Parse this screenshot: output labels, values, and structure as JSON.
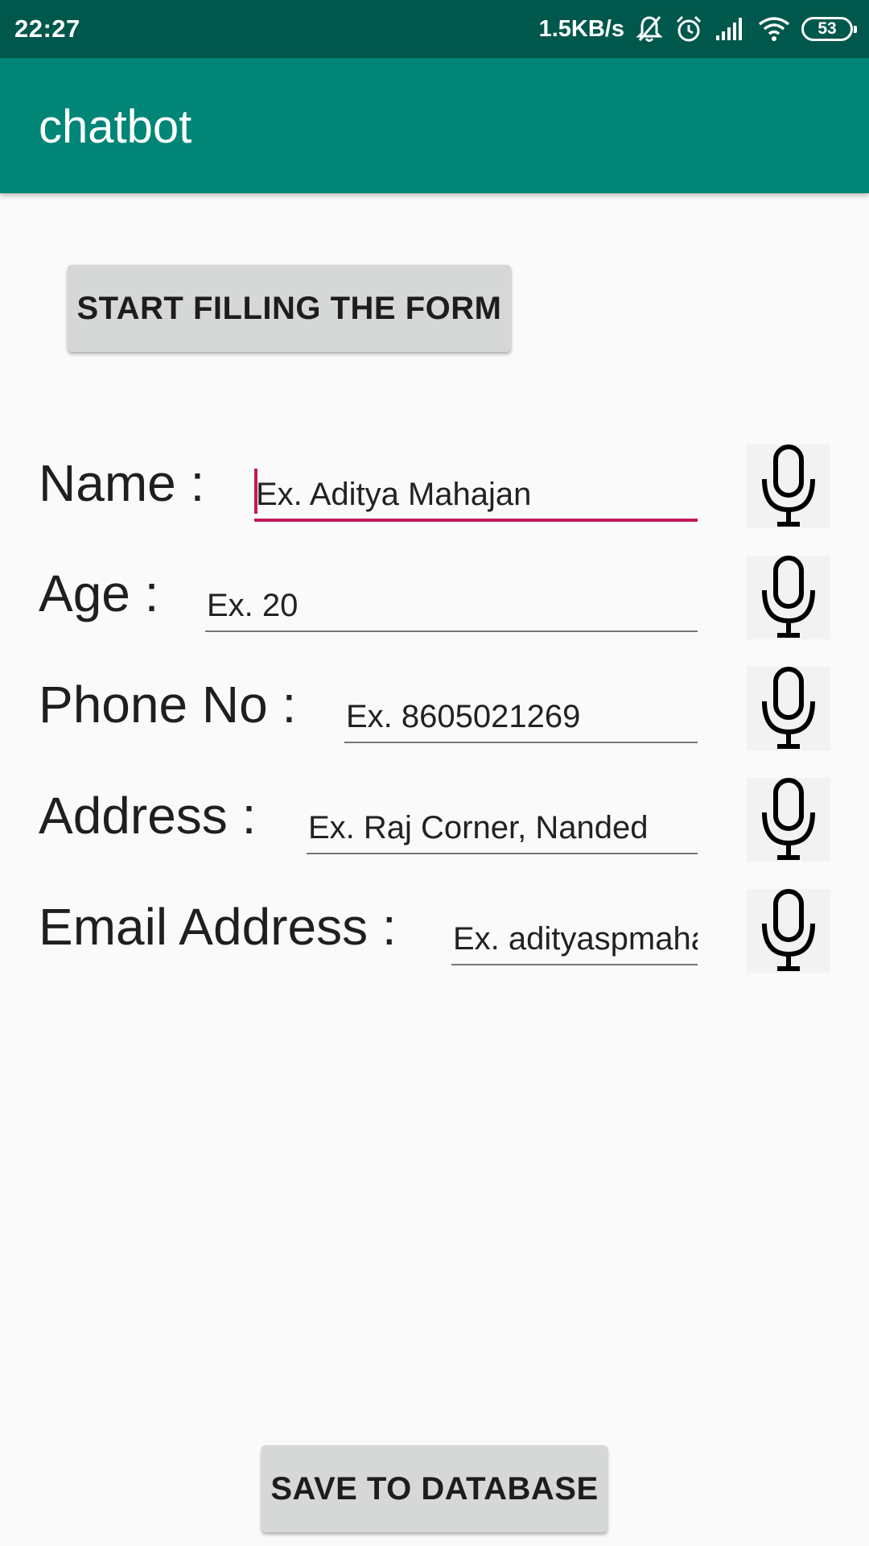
{
  "status_bar": {
    "time": "22:27",
    "net_speed": "1.5KB/s",
    "battery": "53",
    "icons": [
      "mute-icon",
      "alarm-icon",
      "signal-icon",
      "wifi-icon",
      "battery-icon"
    ]
  },
  "app_bar": {
    "title": "chatbot"
  },
  "start_button": {
    "label": "START FILLING THE FORM"
  },
  "form": {
    "fields": [
      {
        "label": "Name :",
        "placeholder": "Ex. Aditya Mahajan",
        "value": "",
        "focused": true,
        "mic_icon": "microphone-icon"
      },
      {
        "label": "Age :",
        "placeholder": "Ex. 20",
        "value": "",
        "focused": false,
        "mic_icon": "microphone-icon"
      },
      {
        "label": "Phone No :",
        "placeholder": "Ex. 8605021269",
        "value": "",
        "focused": false,
        "mic_icon": "microphone-icon"
      },
      {
        "label": "Address :",
        "placeholder": "Ex. Raj Corner, Nanded",
        "value": "",
        "focused": false,
        "mic_icon": "microphone-icon"
      },
      {
        "label": "Email Address :",
        "placeholder": "Ex. adityaspmahajan@gmail.com",
        "value": "",
        "focused": false,
        "mic_icon": "microphone-icon"
      }
    ]
  },
  "save_button": {
    "label": "SAVE TO DATABASE"
  },
  "colors": {
    "status_bar": "#00574b",
    "app_bar": "#008577",
    "accent": "#c2185b",
    "button": "#d6d7d7",
    "background": "#fafafa"
  }
}
